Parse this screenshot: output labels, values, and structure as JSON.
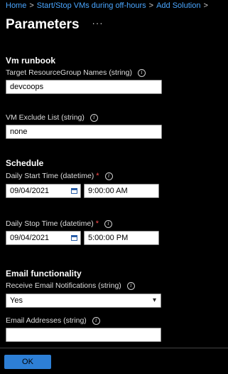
{
  "breadcrumb": [
    "Home",
    "Start/Stop VMs during off-hours",
    "Add Solution"
  ],
  "header": {
    "title": "Parameters",
    "more": "···"
  },
  "sections": {
    "vm_runbook": "Vm runbook",
    "schedule": "Schedule",
    "email": "Email functionality"
  },
  "fields": {
    "target_rg": {
      "label": "Target ResourceGroup Names (string)",
      "value": "devcoops"
    },
    "vm_exclude": {
      "label": "VM Exclude List (string)",
      "value": "none"
    },
    "daily_start": {
      "label": "Daily Start Time (datetime)",
      "date": "09/04/2021",
      "time": "9:00:00 AM"
    },
    "daily_stop": {
      "label": "Daily Stop Time (datetime)",
      "date": "09/04/2021",
      "time": "5:00:00 PM"
    },
    "receive_email": {
      "label": "Receive Email Notifications (string)",
      "value": "Yes"
    },
    "email_addresses": {
      "label": "Email Addresses (string)",
      "value": ""
    }
  },
  "symbols": {
    "info": "i",
    "required": "*",
    "chevron": "▾",
    "separator": ">"
  },
  "footer": {
    "ok_label": "OK"
  },
  "colors": {
    "link": "#4aa6ff",
    "accent": "#2d7fd6",
    "required": "#ff4d4d",
    "background": "#000000"
  }
}
